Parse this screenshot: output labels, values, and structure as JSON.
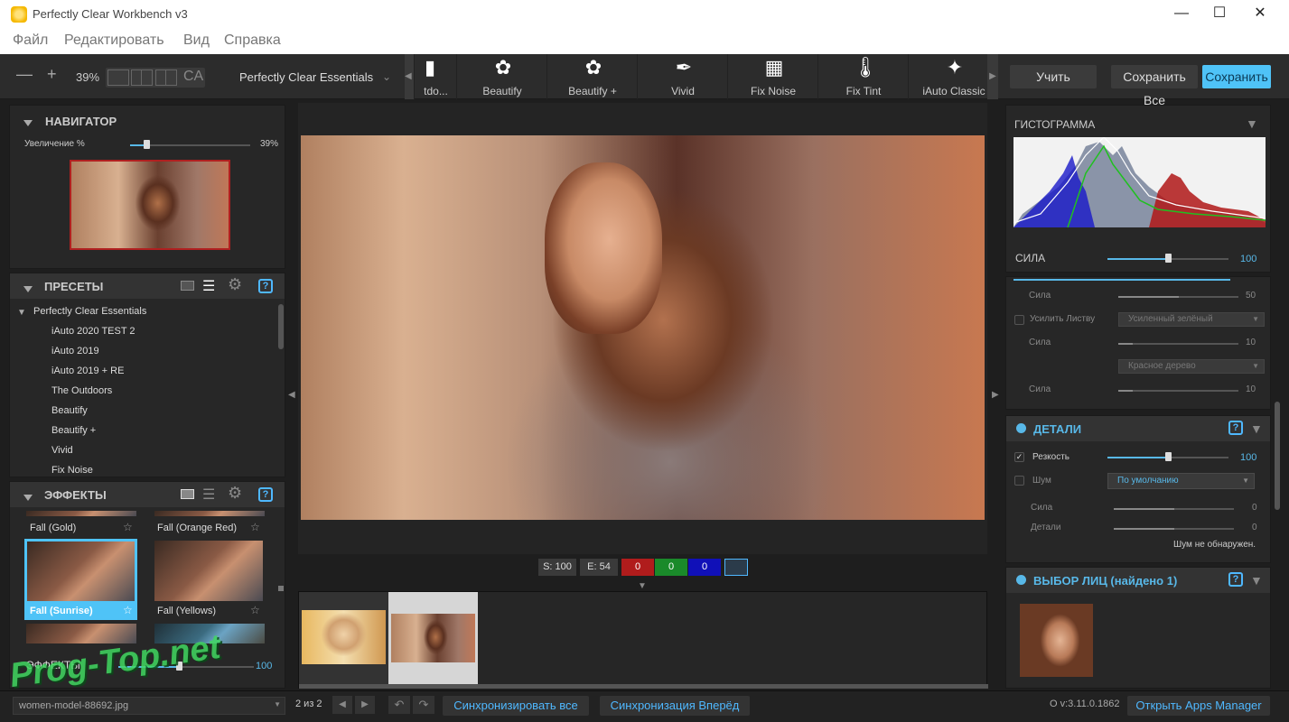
{
  "app": {
    "title": "Perfectly Clear Workbench v3"
  },
  "menu": [
    "Файл",
    "Редактировать",
    "Вид",
    "Справка"
  ],
  "toolbar": {
    "zoom": "39%",
    "ca_label": "CA",
    "preset_group": "Perfectly Clear Essentials",
    "tabs": [
      {
        "label": "tdo...",
        "icon": "tdo-icon"
      },
      {
        "label": "Beautify",
        "icon": "beautify-icon"
      },
      {
        "label": "Beautify +",
        "icon": "beautify-plus-icon"
      },
      {
        "label": "Vivid",
        "icon": "brush-icon"
      },
      {
        "label": "Fix Noise",
        "icon": "noise-icon"
      },
      {
        "label": "Fix Tint",
        "icon": "thermometer-icon"
      },
      {
        "label": "iAuto Classic",
        "icon": "wand-hd-icon"
      }
    ],
    "learn": "Учить",
    "save_all": "Сохранить Все",
    "save": "Сохранить"
  },
  "navigator": {
    "title": "НАВИГАТОР",
    "zoom_label": "Увеличение %",
    "zoom_value": "39%",
    "zoom_level": 0.39
  },
  "presets": {
    "title": "ПРЕСЕТЫ",
    "group": "Perfectly Clear Essentials",
    "items": [
      "iAuto 2020 TEST 2",
      "iAuto 2019",
      "iAuto 2019 + RE",
      "The Outdoors",
      "Beautify",
      "Beautify +",
      "Vivid",
      "Fix Noise"
    ]
  },
  "effects": {
    "title": "ЭФФЕКТЫ",
    "items": [
      "Fall (Gold)",
      "Fall (Orange Red)",
      "Fall (Sunrise)",
      "Fall (Yellows)"
    ],
    "slider_label": "ЭФФЕКТЫ",
    "slider_value": "100"
  },
  "stats": {
    "s": "S: 100",
    "e": "E: 54",
    "r": "0",
    "g": "0",
    "b": "0"
  },
  "status": {
    "filename": "women-model-88692.jpg",
    "counter": "2 из 2",
    "sync_all": "Синхронизировать все",
    "sync_forward": "Синхронизация Вперёд",
    "version": "О v:3.11.0.1862",
    "apps_manager": "Открыть Apps Manager"
  },
  "right": {
    "histogram_title": "ГИСТОГРАММА",
    "strength_label": "СИЛА",
    "strength_value": "100",
    "sila": "Сила",
    "sila1_value": "50",
    "enhance_foliage": "Усилить Листву",
    "foliage_dd": "Усиленный зелёный",
    "sila2_value": "10",
    "redwood_dd": "Красное дерево",
    "sila3_value": "10",
    "details_title": "ДЕТАЛИ",
    "sharpness": "Резкость",
    "sharpness_value": "100",
    "noise": "Шум",
    "noise_dd": "По умолчанию",
    "noise_sila": "Сила",
    "noise_sila_value": "0",
    "noise_details": "Детали",
    "noise_details_value": "0",
    "noise_note": "Шум не обнаружен.",
    "faces_title": "ВЫБОР ЛИЦ (найдено 1)"
  },
  "watermark": "Prog-Top.net",
  "colors": {
    "accent": "#58b8e8",
    "save_bg": "#4fc3f7",
    "red": "#b01c1c",
    "green": "#1a8a2a",
    "blue": "#1010b8"
  }
}
